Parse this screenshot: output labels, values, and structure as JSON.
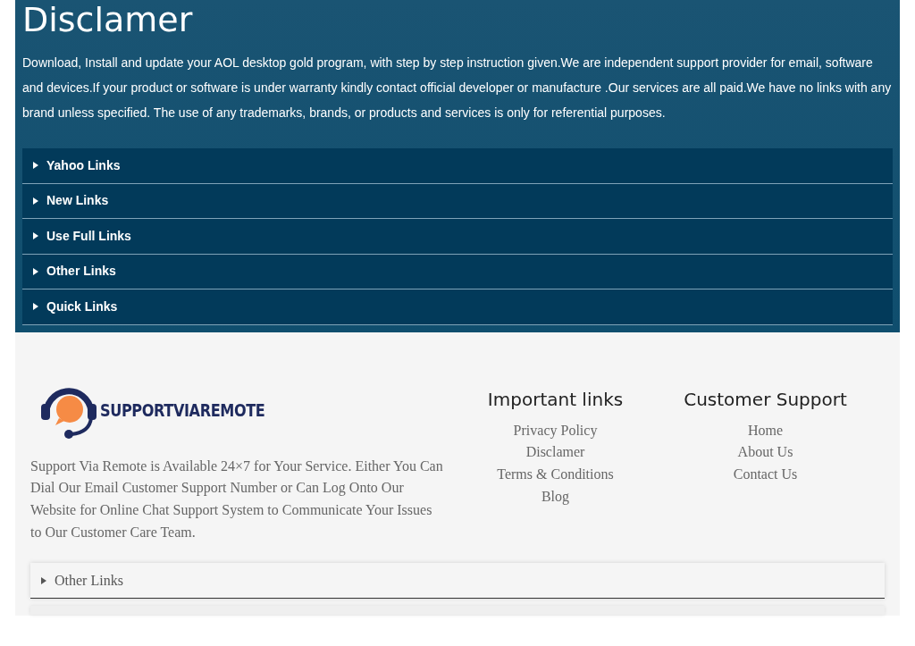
{
  "disclaimer": {
    "title": "Disclamer",
    "body": "Download, Install and update your AOL desktop gold program, with step by step instruction given.We are independent support provider for email, software and devices.If your product or software is under warranty kindly contact official developer or manufacture .Our services are all paid.We have no links with any brand unless specified. The use of any trademarks, brands, or products and services is only for referential purposes.",
    "accordion": [
      {
        "label": "Yahoo Links",
        "expanded": false
      },
      {
        "label": "New Links",
        "expanded": false
      },
      {
        "label": "Use Full Links",
        "expanded": false
      },
      {
        "label": "Other Links",
        "expanded": false
      },
      {
        "label": "Quick Links",
        "expanded": false
      }
    ]
  },
  "footer": {
    "logo_text": "SUPPORTVIAREMOTE",
    "about": "Support Via Remote is Available 24×7 for Your Service. Either You Can Dial Our Email Customer Support Number or Can Log Onto Our Website for Online Chat Support System to Communicate Your Issues to Our Customer Care Team.",
    "columns": [
      {
        "heading": "Important links",
        "links": [
          "Privacy Policy",
          "Disclamer",
          "Terms & Conditions",
          "Blog"
        ]
      },
      {
        "heading": "Customer Support",
        "links": [
          "Home",
          "About Us",
          "Contact Us"
        ]
      }
    ],
    "accordion": [
      {
        "label": "Other Links",
        "expanded": false
      }
    ]
  }
}
